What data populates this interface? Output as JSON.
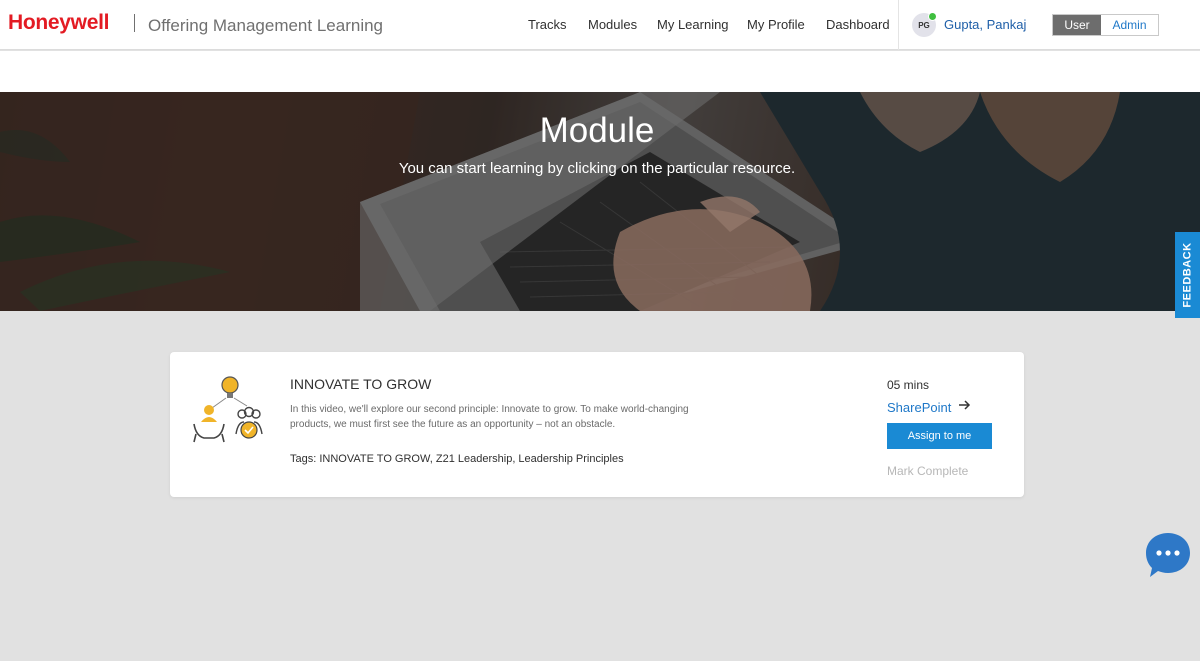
{
  "header": {
    "logo": "Honeywell",
    "app_title": "Offering Management Learning",
    "nav": [
      "Tracks",
      "Modules",
      "My Learning",
      "My Profile",
      "Dashboard"
    ],
    "avatar_initials": "PG",
    "user_name": "Gupta, Pankaj",
    "role_toggle": {
      "user": "User",
      "admin": "Admin",
      "selected": "User"
    }
  },
  "hero": {
    "title": "Module",
    "subtitle": "You can start learning by clicking on the particular resource."
  },
  "feedback_tab": "FEEDBACK",
  "module": {
    "title": "INNOVATE TO GROW",
    "description": "In this video, we'll explore our second principle: Innovate to grow. To make world-changing products, we must first see the future as an opportunity – not an obstacle.",
    "tags": "Tags: INNOVATE TO GROW, Z21 Leadership, Leadership Principles",
    "duration": "05 mins",
    "resource_link": "SharePoint",
    "assign_label": "Assign to me",
    "mark_complete_label": "Mark Complete"
  },
  "colors": {
    "brand_red": "#e31b23",
    "accent_blue": "#1a8ad4",
    "link_blue": "#1f78c8",
    "page_bg": "#e1e1e1"
  }
}
